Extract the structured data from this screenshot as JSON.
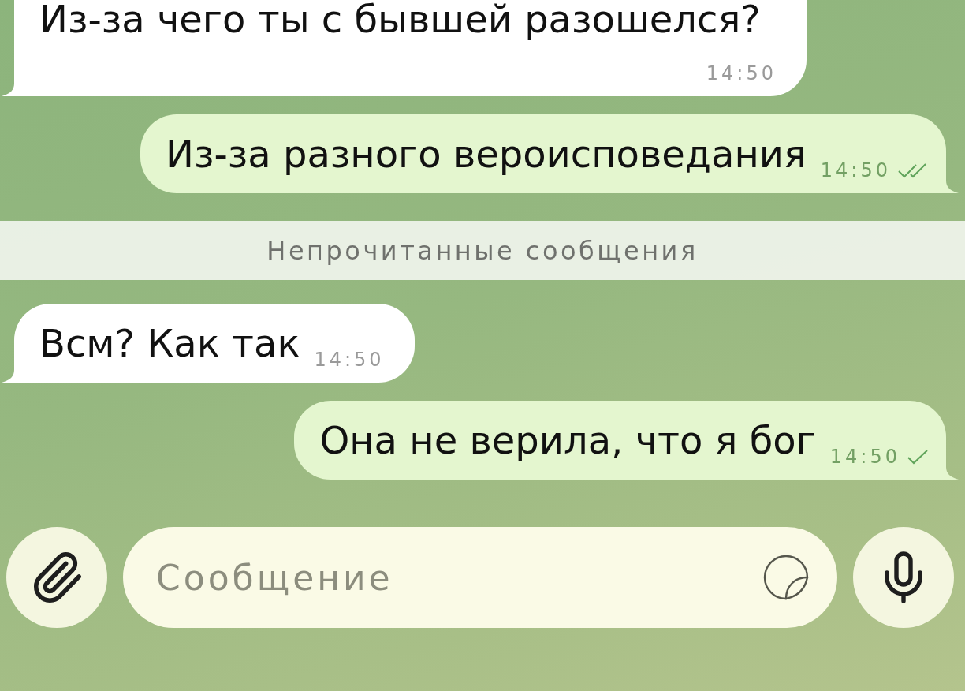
{
  "messages": [
    {
      "kind": "incoming",
      "text": "Из-за чего ты с бывшей разошелся?",
      "time": "14:50"
    },
    {
      "kind": "outgoing",
      "text": "Из-за разного вероисповедания",
      "time": "14:50",
      "read": true
    },
    {
      "kind": "divider",
      "text": "Непрочитанные сообщения"
    },
    {
      "kind": "incoming",
      "text": "Всм? Как так",
      "time": "14:50"
    },
    {
      "kind": "outgoing",
      "text": "Она не верила, что я бог",
      "time": "14:50",
      "read": false
    }
  ],
  "composer": {
    "placeholder": "Сообщение"
  }
}
